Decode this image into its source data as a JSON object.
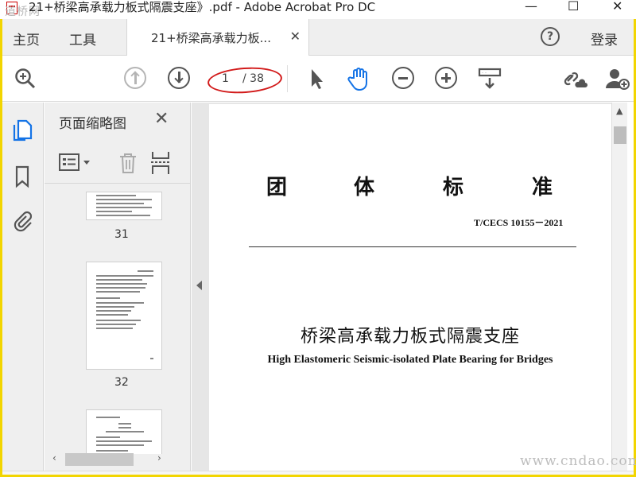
{
  "titlebar": {
    "title": "21+桥梁高承载力板式隔震支座》.pdf - Adobe Acrobat Pro DC",
    "watermark": "道桥网",
    "minimize": "—",
    "maximize": "☐",
    "close": "✕"
  },
  "menu": {
    "home": "主页",
    "tools": "工具",
    "doc_tab": "21+桥梁高承载力板...",
    "help": "?",
    "login": "登录"
  },
  "toolbar": {
    "current_page": "1",
    "total_pages": "/ 38"
  },
  "thumbnails": {
    "header": "页面缩略图",
    "pages": [
      "31",
      "32"
    ]
  },
  "document": {
    "standard_title": [
      "团",
      "体",
      "标",
      "准"
    ],
    "standard_number": "T/CECS 10155－2021",
    "title_zh": "桥梁高承载力板式隔震支座",
    "title_en": "High Elastomeric Seismic-isolated Plate Bearing for Bridges"
  },
  "site_watermark": "www.cndao.com",
  "colors": {
    "accent_blue": "#1473e6",
    "highlight_red": "#d21a1a",
    "frame_yellow": "#f2d500"
  }
}
